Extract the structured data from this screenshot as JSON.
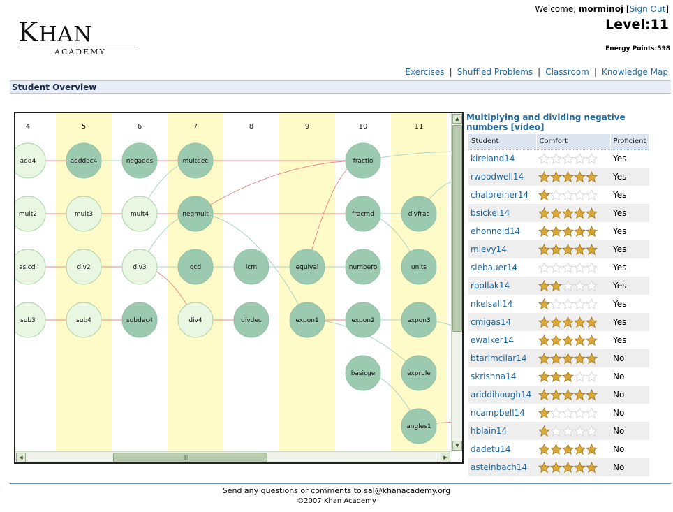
{
  "brand": {
    "logo_main": "Khan",
    "logo_sub": "ACADEMY"
  },
  "user": {
    "welcome_prefix": "Welcome,",
    "username": "morminoj",
    "sign_out_label": "Sign Out",
    "level_label": "Level:11",
    "energy_label": "Energy Points:598"
  },
  "nav": {
    "items": [
      {
        "label": "Exercises"
      },
      {
        "label": "Shuffled Problems"
      },
      {
        "label": "Classroom"
      },
      {
        "label": "Knowledge Map"
      }
    ]
  },
  "section_title": "Student Overview",
  "map": {
    "columns": [
      {
        "label": "4",
        "shaded": false
      },
      {
        "label": "5",
        "shaded": true
      },
      {
        "label": "6",
        "shaded": false
      },
      {
        "label": "7",
        "shaded": true
      },
      {
        "label": "8",
        "shaded": false
      },
      {
        "label": "9",
        "shaded": true
      },
      {
        "label": "10",
        "shaded": false
      },
      {
        "label": "11",
        "shaded": true
      }
    ],
    "nodes": [
      {
        "id": "add4",
        "label": "add4",
        "col": 0,
        "row": 0,
        "status": "light"
      },
      {
        "id": "mult2",
        "label": "mult2",
        "col": 0,
        "row": 1,
        "status": "light"
      },
      {
        "id": "basicdi",
        "label": "asicdi",
        "col": 0,
        "row": 2,
        "status": "light"
      },
      {
        "id": "sub3",
        "label": "sub3",
        "col": 0,
        "row": 3,
        "status": "light"
      },
      {
        "id": "adddec4",
        "label": "adddec4",
        "col": 1,
        "row": 0,
        "status": "dark"
      },
      {
        "id": "mult3",
        "label": "mult3",
        "col": 1,
        "row": 1,
        "status": "light"
      },
      {
        "id": "div2",
        "label": "div2",
        "col": 1,
        "row": 2,
        "status": "light"
      },
      {
        "id": "sub4",
        "label": "sub4",
        "col": 1,
        "row": 3,
        "status": "light"
      },
      {
        "id": "negadds",
        "label": "negadds",
        "col": 2,
        "row": 0,
        "status": "dark"
      },
      {
        "id": "mult4",
        "label": "mult4",
        "col": 2,
        "row": 1,
        "status": "light"
      },
      {
        "id": "div3",
        "label": "div3",
        "col": 2,
        "row": 2,
        "status": "light"
      },
      {
        "id": "subdec4",
        "label": "subdec4",
        "col": 2,
        "row": 3,
        "status": "dark"
      },
      {
        "id": "multdec",
        "label": "multdec",
        "col": 3,
        "row": 0,
        "status": "dark"
      },
      {
        "id": "negmult",
        "label": "negmult",
        "col": 3,
        "row": 1,
        "status": "dark"
      },
      {
        "id": "gcd",
        "label": "gcd",
        "col": 3,
        "row": 2,
        "status": "dark"
      },
      {
        "id": "div4",
        "label": "div4",
        "col": 3,
        "row": 3,
        "status": "light"
      },
      {
        "id": "lcm",
        "label": "lcm",
        "col": 4,
        "row": 2,
        "status": "dark"
      },
      {
        "id": "divdec",
        "label": "divdec",
        "col": 4,
        "row": 3,
        "status": "dark"
      },
      {
        "id": "equival",
        "label": "equival",
        "col": 5,
        "row": 2,
        "status": "dark"
      },
      {
        "id": "expon1",
        "label": "expon1",
        "col": 5,
        "row": 3,
        "status": "dark"
      },
      {
        "id": "fractio",
        "label": "fractio",
        "col": 6,
        "row": 0,
        "status": "dark"
      },
      {
        "id": "fracmd",
        "label": "fracmd",
        "col": 6,
        "row": 1,
        "status": "dark"
      },
      {
        "id": "numbero",
        "label": "numbero",
        "col": 6,
        "row": 2,
        "status": "dark"
      },
      {
        "id": "expon2",
        "label": "expon2",
        "col": 6,
        "row": 3,
        "status": "dark"
      },
      {
        "id": "basicge",
        "label": "basicge",
        "col": 6,
        "row": 4,
        "status": "dark"
      },
      {
        "id": "divfrac",
        "label": "divfrac",
        "col": 7,
        "row": 1,
        "status": "dark"
      },
      {
        "id": "units",
        "label": "units",
        "col": 7,
        "row": 2,
        "status": "dark"
      },
      {
        "id": "expon3",
        "label": "expon3",
        "col": 7,
        "row": 3,
        "status": "dark"
      },
      {
        "id": "exprule",
        "label": "exprule",
        "col": 7,
        "row": 4,
        "status": "dark"
      },
      {
        "id": "angles1",
        "label": "angles1",
        "col": 7,
        "row": 5,
        "status": "dark"
      }
    ],
    "edges": [
      {
        "from": "add4",
        "to": "adddec4",
        "color": "red"
      },
      {
        "from": "adddec4",
        "to": "negadds",
        "color": "green"
      },
      {
        "from": "negadds",
        "to": "fractio",
        "color": "red"
      },
      {
        "from": "mult2",
        "to": "mult3",
        "color": "red"
      },
      {
        "from": "mult3",
        "to": "mult4",
        "color": "red"
      },
      {
        "from": "mult4",
        "to": "multdec",
        "color": "green"
      },
      {
        "from": "mult4",
        "to": "negmult",
        "color": "red"
      },
      {
        "from": "negmult",
        "to": "fractio",
        "color": "red"
      },
      {
        "from": "negmult",
        "to": "fracmd",
        "color": "red"
      },
      {
        "from": "negmult",
        "to": "expon1",
        "color": "green"
      },
      {
        "from": "basicdi",
        "to": "div2",
        "color": "red"
      },
      {
        "from": "div2",
        "to": "div3",
        "color": "red"
      },
      {
        "from": "div3",
        "to": "negmult",
        "color": "green"
      },
      {
        "from": "div3",
        "to": "gcd",
        "color": "green"
      },
      {
        "from": "div3",
        "to": "div4",
        "color": "red"
      },
      {
        "from": "gcd",
        "to": "lcm",
        "color": "green"
      },
      {
        "from": "lcm",
        "to": "equival",
        "color": "green"
      },
      {
        "from": "equival",
        "to": "numbero",
        "color": "green"
      },
      {
        "from": "equival",
        "to": "fractio",
        "color": "red"
      },
      {
        "from": "fracmd",
        "to": "divfrac",
        "color": "green"
      },
      {
        "from": "fracmd",
        "to": "units",
        "color": "green"
      },
      {
        "from": "sub3",
        "to": "sub4",
        "color": "red"
      },
      {
        "from": "sub4",
        "to": "subdec4",
        "color": "red"
      },
      {
        "from": "div4",
        "to": "divdec",
        "color": "red"
      },
      {
        "from": "expon1",
        "to": "expon2",
        "color": "red"
      },
      {
        "from": "expon1",
        "to": "exprule",
        "color": "green"
      },
      {
        "from": "expon2",
        "to": "expon3",
        "color": "green"
      },
      {
        "from": "basicge",
        "to": "angles1",
        "color": "green"
      },
      {
        "from": "fractio",
        "to": "offright1",
        "color": "green"
      },
      {
        "from": "divfrac",
        "to": "offright2",
        "color": "green"
      },
      {
        "from": "expon3",
        "to": "offright3",
        "color": "green"
      },
      {
        "from": "angles1",
        "to": "offright4",
        "color": "red"
      }
    ]
  },
  "exercise": {
    "title": "Multiplying and dividing negative numbers [video]"
  },
  "table": {
    "headers": [
      "Student",
      "Comfort",
      "Proficient"
    ],
    "rows": [
      {
        "name": "kireland14",
        "stars": 0,
        "proficient": "Yes"
      },
      {
        "name": "rwoodwell14",
        "stars": 5,
        "proficient": "Yes"
      },
      {
        "name": "chalbreiner14",
        "stars": 1,
        "proficient": "Yes"
      },
      {
        "name": "bsickel14",
        "stars": 5,
        "proficient": "Yes"
      },
      {
        "name": "ehonnold14",
        "stars": 5,
        "proficient": "Yes"
      },
      {
        "name": "mlevy14",
        "stars": 5,
        "proficient": "Yes"
      },
      {
        "name": "slebauer14",
        "stars": 0,
        "proficient": "Yes"
      },
      {
        "name": "rpollak14",
        "stars": 2,
        "proficient": "Yes"
      },
      {
        "name": "nkelsall14",
        "stars": 1,
        "proficient": "Yes"
      },
      {
        "name": "cmigas14",
        "stars": 5,
        "proficient": "Yes"
      },
      {
        "name": "ewalker14",
        "stars": 5,
        "proficient": "Yes"
      },
      {
        "name": "btarimcilar14",
        "stars": 5,
        "proficient": "No"
      },
      {
        "name": "skrishna14",
        "stars": 3,
        "proficient": "No"
      },
      {
        "name": "ariddihough14",
        "stars": 5,
        "proficient": "No"
      },
      {
        "name": "ncampbell14",
        "stars": 1,
        "proficient": "No"
      },
      {
        "name": "hblain14",
        "stars": 1,
        "proficient": "No"
      },
      {
        "name": "dadetu14",
        "stars": 5,
        "proficient": "No"
      },
      {
        "name": "asteinbach14",
        "stars": 5,
        "proficient": "No"
      }
    ]
  },
  "footer": {
    "contact": "Send any questions or comments to sal@khanacademy.org",
    "copyright": "©2007 Khan Academy"
  },
  "colors": {
    "link": "#23689b",
    "node_dark": "#9ccab0",
    "node_light": "#e8f6e2",
    "column_shade": "#fffbc8",
    "edge_red": "#e98888",
    "edge_green": "#a9d4c6",
    "star_gold": "#d9a93a"
  },
  "icons": {
    "scroll_up": "arrow-up-icon",
    "scroll_down": "arrow-down-icon",
    "scroll_left": "arrow-left-icon",
    "scroll_right": "arrow-right-icon",
    "star": "star-icon"
  }
}
